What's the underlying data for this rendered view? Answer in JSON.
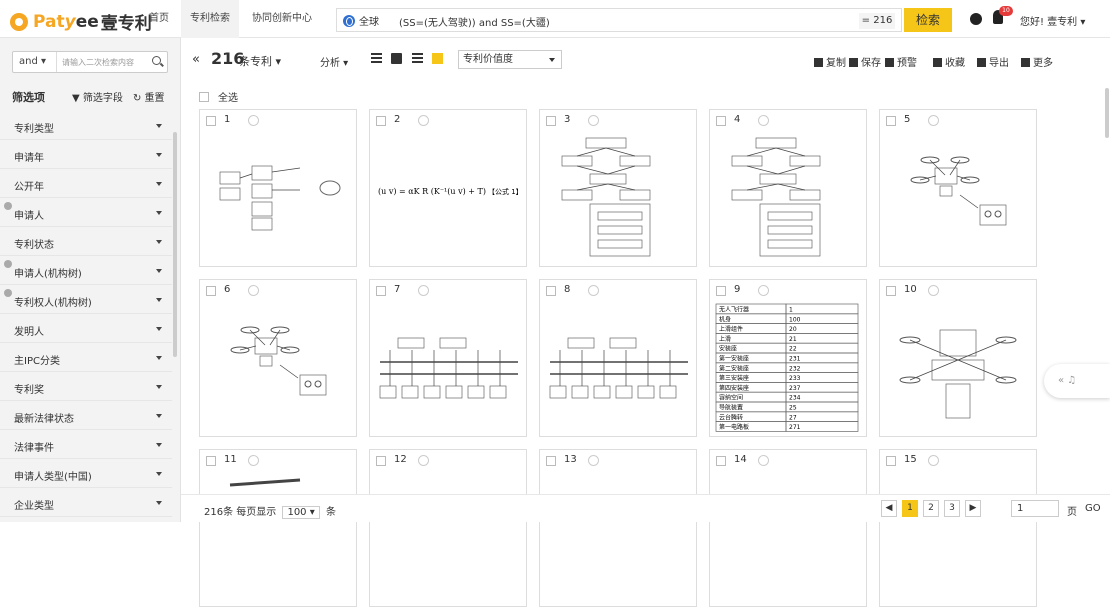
{
  "header": {
    "logo_brand": "Pat",
    "logo_y": "y",
    "logo_ee": "ee",
    "logo_cn": "壹专利",
    "nav": [
      "首页",
      "专利检索",
      "协同创新中心"
    ],
    "scope": "全球",
    "query": "(SS=(无人驾驶)) and SS=(大疆)",
    "result_count": "= 216",
    "search_button": "检索",
    "notification_count": "10",
    "greeting": "您好! 壹专利 ▾"
  },
  "sidebar": {
    "logic_select": "and ▾",
    "search_placeholder": "请输入二次检索内容",
    "title": "筛选项",
    "field_button": "▼ 筛选字段",
    "reset_button": "↻ 重置",
    "facets": [
      "专利类型",
      "申请年",
      "公开年",
      "申请人",
      "专利状态",
      "申请人(机构树)",
      "专利权人(机构树)",
      "发明人",
      "主IPC分类",
      "专利奖",
      "最新法律状态",
      "法律事件",
      "申请人类型(中国)",
      "企业类型"
    ],
    "facets_with_help": [
      3,
      5,
      6
    ]
  },
  "toolbar": {
    "collapse": "«",
    "total": "216",
    "unit": "条专利 ▾",
    "analyze": "分析 ▾",
    "sort": "专利价值度",
    "actions": [
      "复制",
      "保存",
      "预警",
      "收藏",
      "导出",
      "更多"
    ]
  },
  "grid": {
    "select_all": "全选",
    "cards": [
      "1",
      "2",
      "3",
      "4",
      "5",
      "6",
      "7",
      "8",
      "9",
      "10",
      "11",
      "12",
      "13",
      "14",
      "15"
    ],
    "formula_label": "【公式 1】",
    "table9_rows": [
      [
        "无人飞行器",
        "1"
      ],
      [
        "机身",
        "100"
      ],
      [
        "上滑组件",
        "20"
      ],
      [
        "上滑",
        "21"
      ],
      [
        "安装座",
        "22"
      ],
      [
        "第一安装座",
        "231"
      ],
      [
        "第二安装座",
        "232"
      ],
      [
        "第三安装座",
        "233"
      ],
      [
        "第四安装座",
        "237"
      ],
      [
        "容纳空间",
        "234"
      ],
      [
        "导航装置",
        "25"
      ],
      [
        "云台腾转",
        "27"
      ],
      [
        "第一电路板",
        "271"
      ]
    ]
  },
  "pagination": {
    "summary": "216条  每页显示",
    "per_page": "100 ▾",
    "unit": "条",
    "pages": [
      "1",
      "2",
      "3"
    ],
    "prev": "◀",
    "next": "▶",
    "goto_value": "1",
    "page_label": "页",
    "go": "GO"
  },
  "float": {
    "label": "« ♫"
  }
}
